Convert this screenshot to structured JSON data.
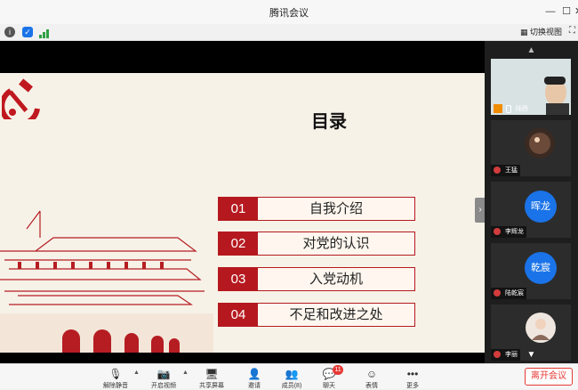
{
  "window": {
    "title": "腾讯会议"
  },
  "statusbar": {
    "switch_view_label": "切换视图"
  },
  "slide": {
    "title": "目录",
    "items": [
      {
        "num": "01",
        "text": "自我介绍"
      },
      {
        "num": "02",
        "text": "对党的认识"
      },
      {
        "num": "03",
        "text": "入党动机"
      },
      {
        "num": "04",
        "text": "不足和改进之处"
      }
    ]
  },
  "participants": [
    {
      "name": "陆西",
      "avatar_text": ""
    },
    {
      "name": "王猛",
      "avatar_text": ""
    },
    {
      "name": "李辉龙",
      "avatar_text": "晖龙"
    },
    {
      "name": "陆乾宸",
      "avatar_text": "乾宸"
    },
    {
      "name": "李丽",
      "avatar_text": ""
    }
  ],
  "toolbar": {
    "items": [
      {
        "label": "解除静音",
        "icon": "mic-muted-icon"
      },
      {
        "label": "开启视频",
        "icon": "camera-off-icon"
      },
      {
        "label": "共享屏幕",
        "icon": "share-screen-icon"
      },
      {
        "label": "邀请",
        "icon": "invite-icon"
      },
      {
        "label": "成员(8)",
        "icon": "members-icon"
      },
      {
        "label": "聊天",
        "icon": "chat-icon",
        "badge": "11"
      },
      {
        "label": "表情",
        "icon": "emoji-icon"
      },
      {
        "label": "更多",
        "icon": "more-icon"
      }
    ],
    "leave_label": "离开会议"
  },
  "colors": {
    "accent_red": "#b5191f",
    "tile_blue": "#1a73e8",
    "leave_red": "#e53935"
  }
}
